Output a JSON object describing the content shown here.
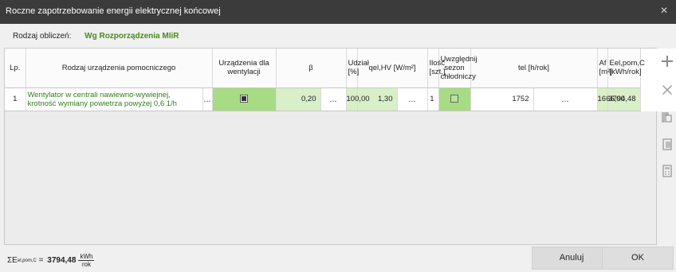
{
  "window": {
    "title": "Roczne zapotrzebowanie energii elektrycznej końcowej",
    "close": "×"
  },
  "calc": {
    "label": "Rodzaj obliczeń:",
    "value": "Wg Rozporządzenia MIiR"
  },
  "table": {
    "headers": {
      "lp": "Lp.",
      "device": "Rodzaj urządzenia pomocniczego",
      "vent": "Urządzenia dla wentylacji",
      "beta": "β",
      "share": "Udział [%]",
      "qel": "qel,HV [W/m²]",
      "count": "Ilość [szt.]",
      "season": "Uwzględnij sezon chłodniczy",
      "tel": "tel [h/rok]",
      "af": "Af [m²]",
      "eel": "Eel,pom,C [kWh/rok]"
    },
    "rows": [
      {
        "lp": "1",
        "device_line1": "Wentylator w centrali nawiewno-wywiejnej,",
        "device_line2": "krotność wymiany powietrza powyżej 0,6 1/h",
        "vent_checked": true,
        "beta": "0,20",
        "share": "100,00",
        "qel": "1,30",
        "count": "1",
        "season_checked": false,
        "tel": "1752",
        "af": "1666,00",
        "eel": "3794,48"
      }
    ],
    "dots": "..."
  },
  "sidebar": {
    "add": "add-icon",
    "delete": "delete-icon",
    "copy": "copy-icon",
    "paste": "paste-icon",
    "calc": "calculator-icon"
  },
  "summary": {
    "symbol": "ΣE",
    "subscript": "el,pom,C",
    "eq": " = ",
    "value": "3794,48",
    "unit_num": "kWh",
    "unit_den": "rok"
  },
  "buttons": {
    "cancel": "Anuluj",
    "ok": "OK"
  },
  "colors": {
    "accent_green": "#4a8a1e",
    "cell_green": "#a8dc84",
    "title_bg": "#3b3b3b"
  }
}
